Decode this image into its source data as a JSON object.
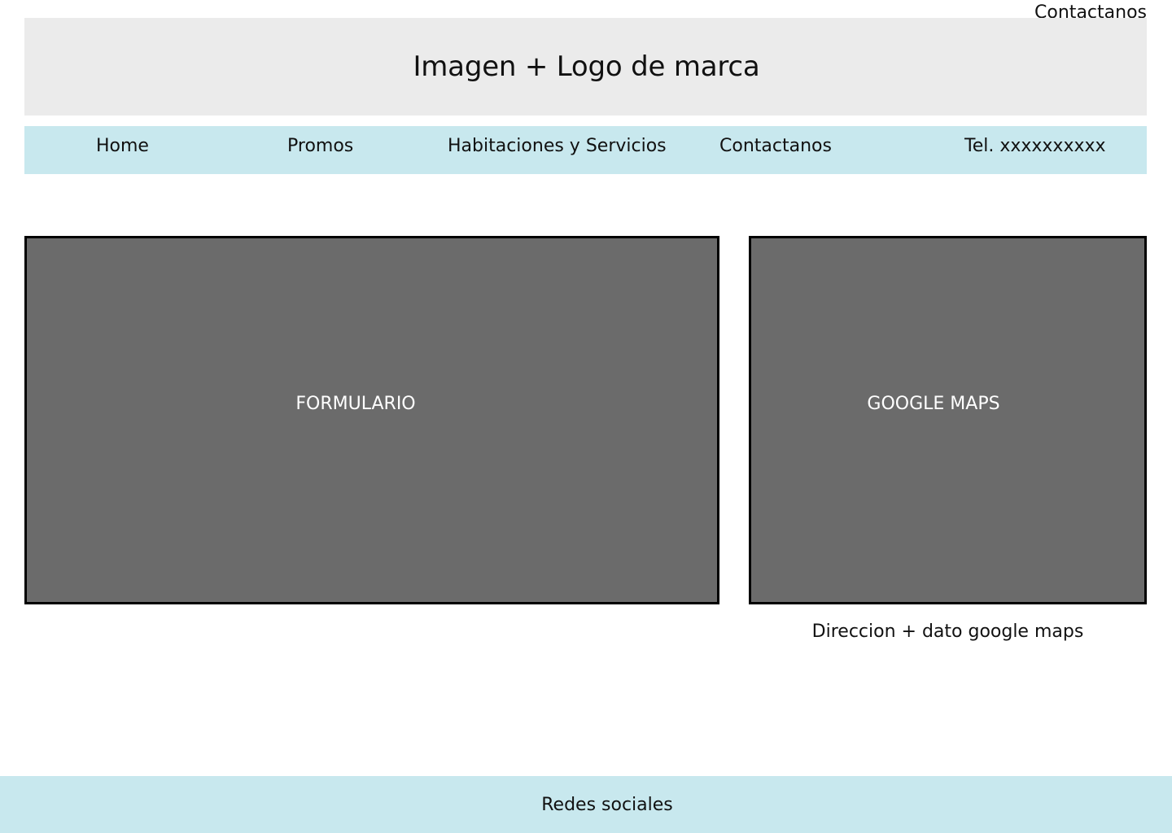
{
  "page": {
    "label": "Contactanos"
  },
  "hero": {
    "text": "Imagen + Logo de marca"
  },
  "nav": {
    "home": "Home",
    "promos": "Promos",
    "habitaciones": "Habitaciones y Servicios",
    "contactanos": "Contactanos",
    "telefono": "Tel. xxxxxxxxxx"
  },
  "form": {
    "label": "FORMULARIO"
  },
  "map": {
    "label": "GOOGLE MAPS",
    "address": "Direccion + dato google maps"
  },
  "footer": {
    "text": "Redes sociales"
  },
  "colors": {
    "hero_bg": "#ebebeb",
    "nav_bg": "#c8e8ee",
    "placeholder_bg": "#6b6b6b",
    "border": "#000000"
  }
}
